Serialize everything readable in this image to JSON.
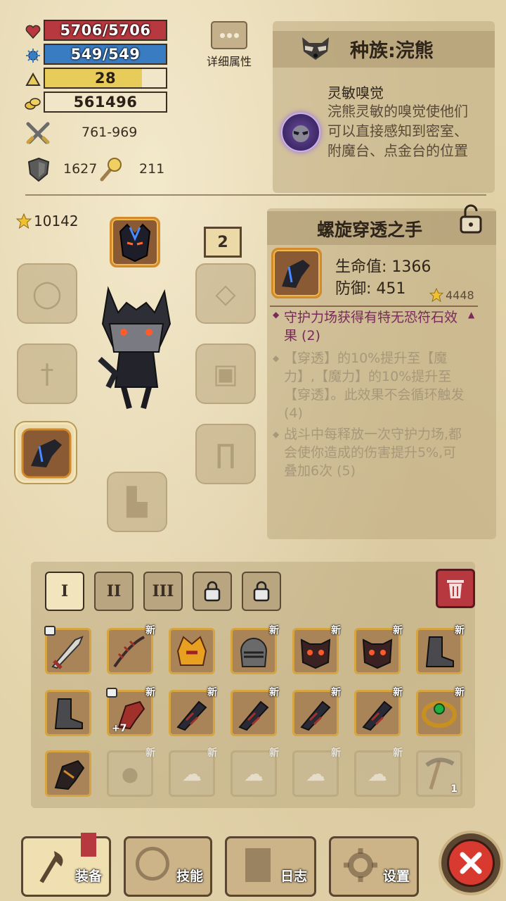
{
  "stats": {
    "hp": "5706/5706",
    "mp": "549/549",
    "level": "28",
    "level_progress": 0.8,
    "gold": "561496",
    "attack": "761-969",
    "defense": "1627",
    "luck": "211"
  },
  "detail_button": {
    "label": "详细属性"
  },
  "race": {
    "title": "种族:浣熊",
    "skill_name": "灵敏嗅觉",
    "skill_desc": "浣熊灵敏的嗅觉使他们可以直接感知到密室、附魔台、点金台的位置"
  },
  "character": {
    "power": "10142",
    "level_badge": "2"
  },
  "item_detail": {
    "name": "螺旋穿透之手",
    "hp_label": "生命值: 1366",
    "def_label": "防御: 451",
    "score": "4448",
    "effect_main": "守护力场获得有特无恐符石效果 (2)",
    "effect_1": "【穿透】的10%提升至【魔力】,【魔力】的10%提升至【穿透】。此效果不会循环触发 (4)",
    "effect_2": "战斗中每释放一次守护力场,都会使你造成的伤害提升5%,可叠加6次 (5)"
  },
  "tabs": [
    "I",
    "II",
    "III"
  ],
  "inventory": {
    "new_label": "新",
    "plus_label": "+7",
    "count_label": "1"
  },
  "nav": {
    "equip": "装备",
    "skills": "技能",
    "log": "日志",
    "settings": "设置"
  },
  "colors": {
    "hp": "#b8383f",
    "mp": "#3a7cc2",
    "level": "#e8cc5a",
    "accent": "#d6a440",
    "effect_text": "#7a2a5a"
  }
}
